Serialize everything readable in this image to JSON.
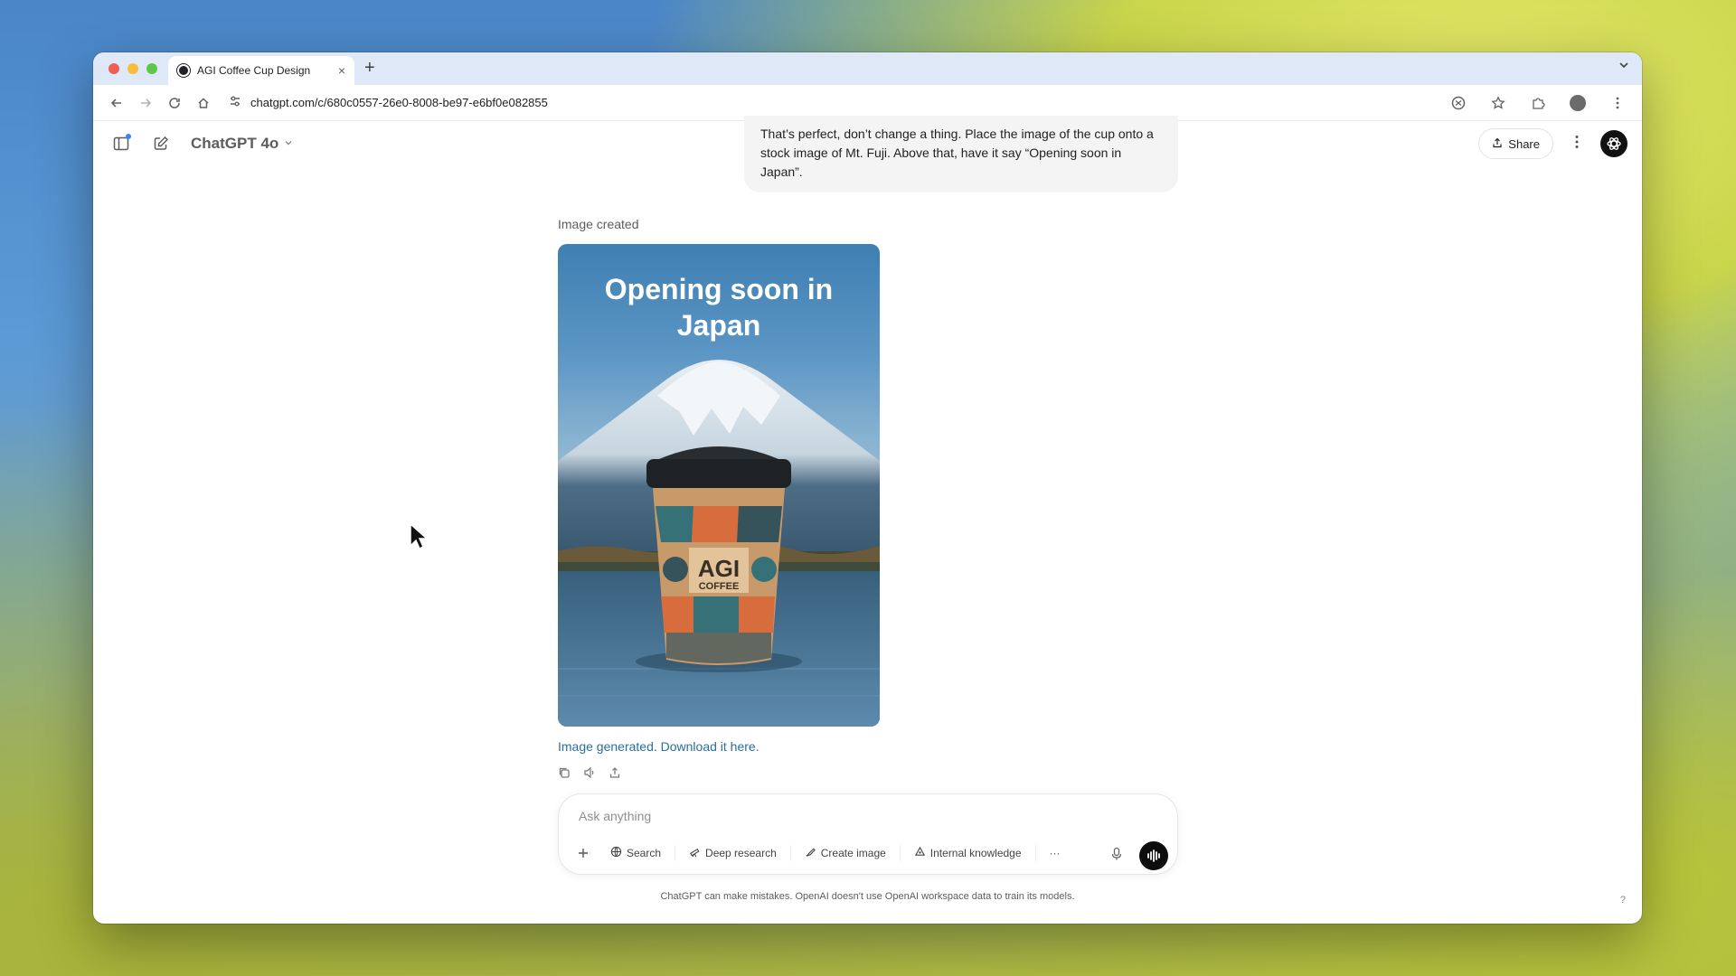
{
  "browser": {
    "tab_title": "AGI Coffee Cup Design",
    "tab_close": "×",
    "new_tab": "+",
    "url": "chatgpt.com/c/680c0557-26e0-8008-be97-e6bf0e082855"
  },
  "header": {
    "model_name": "ChatGPT 4o",
    "share_label": "Share"
  },
  "conversation": {
    "user_message": "That’s perfect, don’t change a thing. Place the image of the cup onto a stock image of Mt. Fuji. Above that, have it say “Opening soon in Japan”.",
    "image_status": "Image created",
    "image_headline_line1": "Opening soon in",
    "image_headline_line2": "Japan",
    "cup_brand": "AGI",
    "cup_sub": "COFFEE",
    "download_text": "Image generated. Download it here."
  },
  "composer": {
    "placeholder": "Ask anything",
    "tools": [
      {
        "label": "Search",
        "icon": "globe-icon"
      },
      {
        "label": "Deep research",
        "icon": "telescope-icon"
      },
      {
        "label": "Create image",
        "icon": "image-brush-icon"
      },
      {
        "label": "Internal knowledge",
        "icon": "knowledge-icon"
      }
    ],
    "more": "···"
  },
  "footer": {
    "disclaimer": "ChatGPT can make mistakes. OpenAI doesn't use OpenAI workspace data to train its models.",
    "help": "?"
  }
}
